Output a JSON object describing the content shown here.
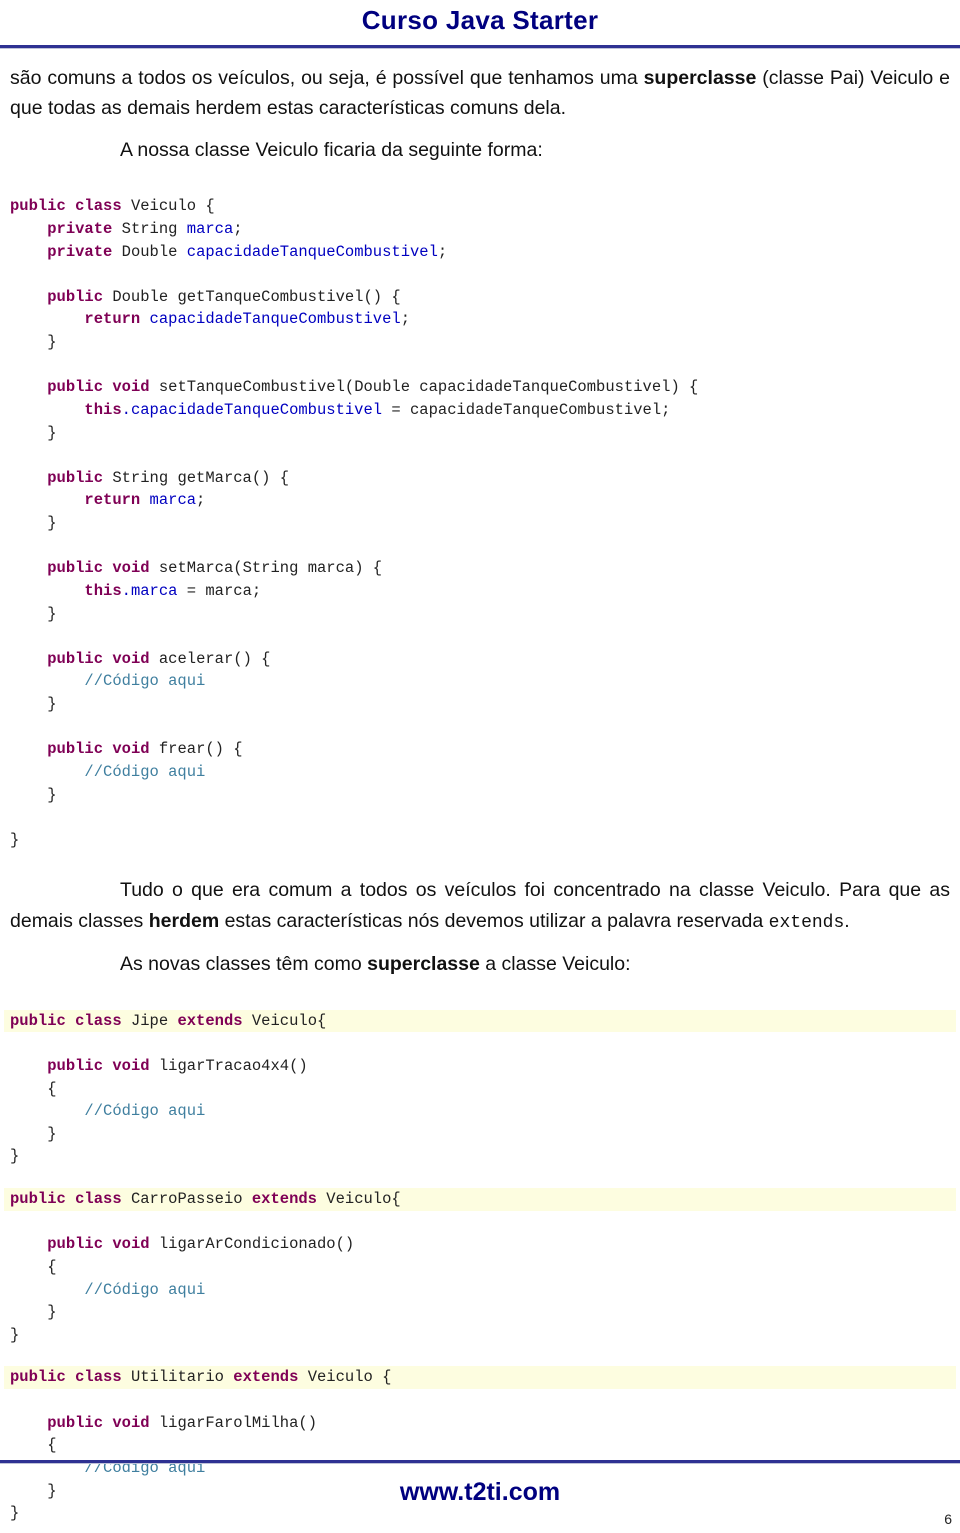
{
  "header": {
    "title": "Curso Java Starter"
  },
  "paragraphs": {
    "p1_a": "são comuns a todos os veículos, ou seja, é possível que tenhamos uma ",
    "p1_b": "superclasse",
    "p1_c": " (classe Pai) Veiculo e que todas as demais herdem estas características comuns dela.",
    "p2": "A nossa classe Veiculo ficaria da seguinte forma:",
    "p3_a": "Tudo o que era comum a todos os veículos foi concentrado na classe Veiculo. Para que as demais classes ",
    "p3_b": "herdem",
    "p3_c": " estas características nós devemos utilizar a palavra reservada ",
    "p3_d": "extends",
    "p3_e": ".",
    "p4_a": "As novas classes têm como ",
    "p4_b": "superclasse",
    "p4_c": " a classe Veiculo:"
  },
  "code_veiculo": {
    "l1_kw1": "public",
    "l1_kw2": "class",
    "l1_rest": " Veiculo {",
    "l2_kw": "private",
    "l2_mid": " String ",
    "l2_field": "marca",
    "l2_end": ";",
    "l3_kw": "private",
    "l3_mid": " Double ",
    "l3_field": "capacidadeTanqueCombustivel",
    "l3_end": ";",
    "l4_kw": "public",
    "l4_rest": " Double getTanqueCombustivel() {",
    "l5_kw": "return",
    "l5_field": " capacidadeTanqueCombustivel",
    "l5_end": ";",
    "l6": "}",
    "l7_kw1": "public",
    "l7_kw2": "void",
    "l7_rest": " setTanqueCombustivel(Double capacidadeTanqueCombustivel) {",
    "l8_kw": "this",
    "l8_field": ".capacidadeTanqueCombustivel",
    "l8_end": " = capacidadeTanqueCombustivel;",
    "l9": "}",
    "l10_kw": "public",
    "l10_rest": " String getMarca() {",
    "l11_kw": "return",
    "l11_field": " marca",
    "l11_end": ";",
    "l12": "}",
    "l13_kw1": "public",
    "l13_kw2": "void",
    "l13_rest": " setMarca(String marca) {",
    "l14_kw": "this",
    "l14_field": ".marca",
    "l14_end": " = marca;",
    "l15": "}",
    "l16_kw1": "public",
    "l16_kw2": "void",
    "l16_rest": " acelerar() {",
    "l17_cmt": "//Código aqui",
    "l18": "}",
    "l19_kw1": "public",
    "l19_kw2": "void",
    "l19_rest": " frear() {",
    "l20_cmt": "//Código aqui",
    "l21": "}",
    "l22": "}"
  },
  "code_jipe": {
    "header_kw1": "public",
    "header_kw2": "class",
    "header_name": " Jipe ",
    "header_kw3": "extends",
    "header_rest": " Veiculo{",
    "m_kw1": "public",
    "m_kw2": "void",
    "m_rest": " ligarTracao4x4()",
    "open": "{",
    "cmt": "//Código aqui",
    "close": "}",
    "close2": "}"
  },
  "code_carro": {
    "header_kw1": "public",
    "header_kw2": "class",
    "header_name": " CarroPasseio ",
    "header_kw3": "extends",
    "header_rest": " Veiculo{",
    "m_kw1": "public",
    "m_kw2": "void",
    "m_rest": " ligarArCondicionado()",
    "open": "{",
    "cmt": "//Código aqui",
    "close": "}",
    "close2": "}"
  },
  "code_utilitario": {
    "header_kw1": "public",
    "header_kw2": "class",
    "header_name": " Utilitario ",
    "header_kw3": "extends",
    "header_rest": " Veiculo {",
    "m_kw1": "public",
    "m_kw2": "void",
    "m_rest": " ligarFarolMilha()",
    "open": "{",
    "cmt": "//Código aqui",
    "close": "}",
    "close2": "}"
  },
  "footer": {
    "site": "www.t2ti.com",
    "page": "6"
  },
  "colors": {
    "title": "#00007f",
    "rule": "#2e3192",
    "keyword": "#7f0055",
    "field": "#0000c0",
    "comment": "#3f7f9f",
    "code_band": "#fdfde0"
  }
}
